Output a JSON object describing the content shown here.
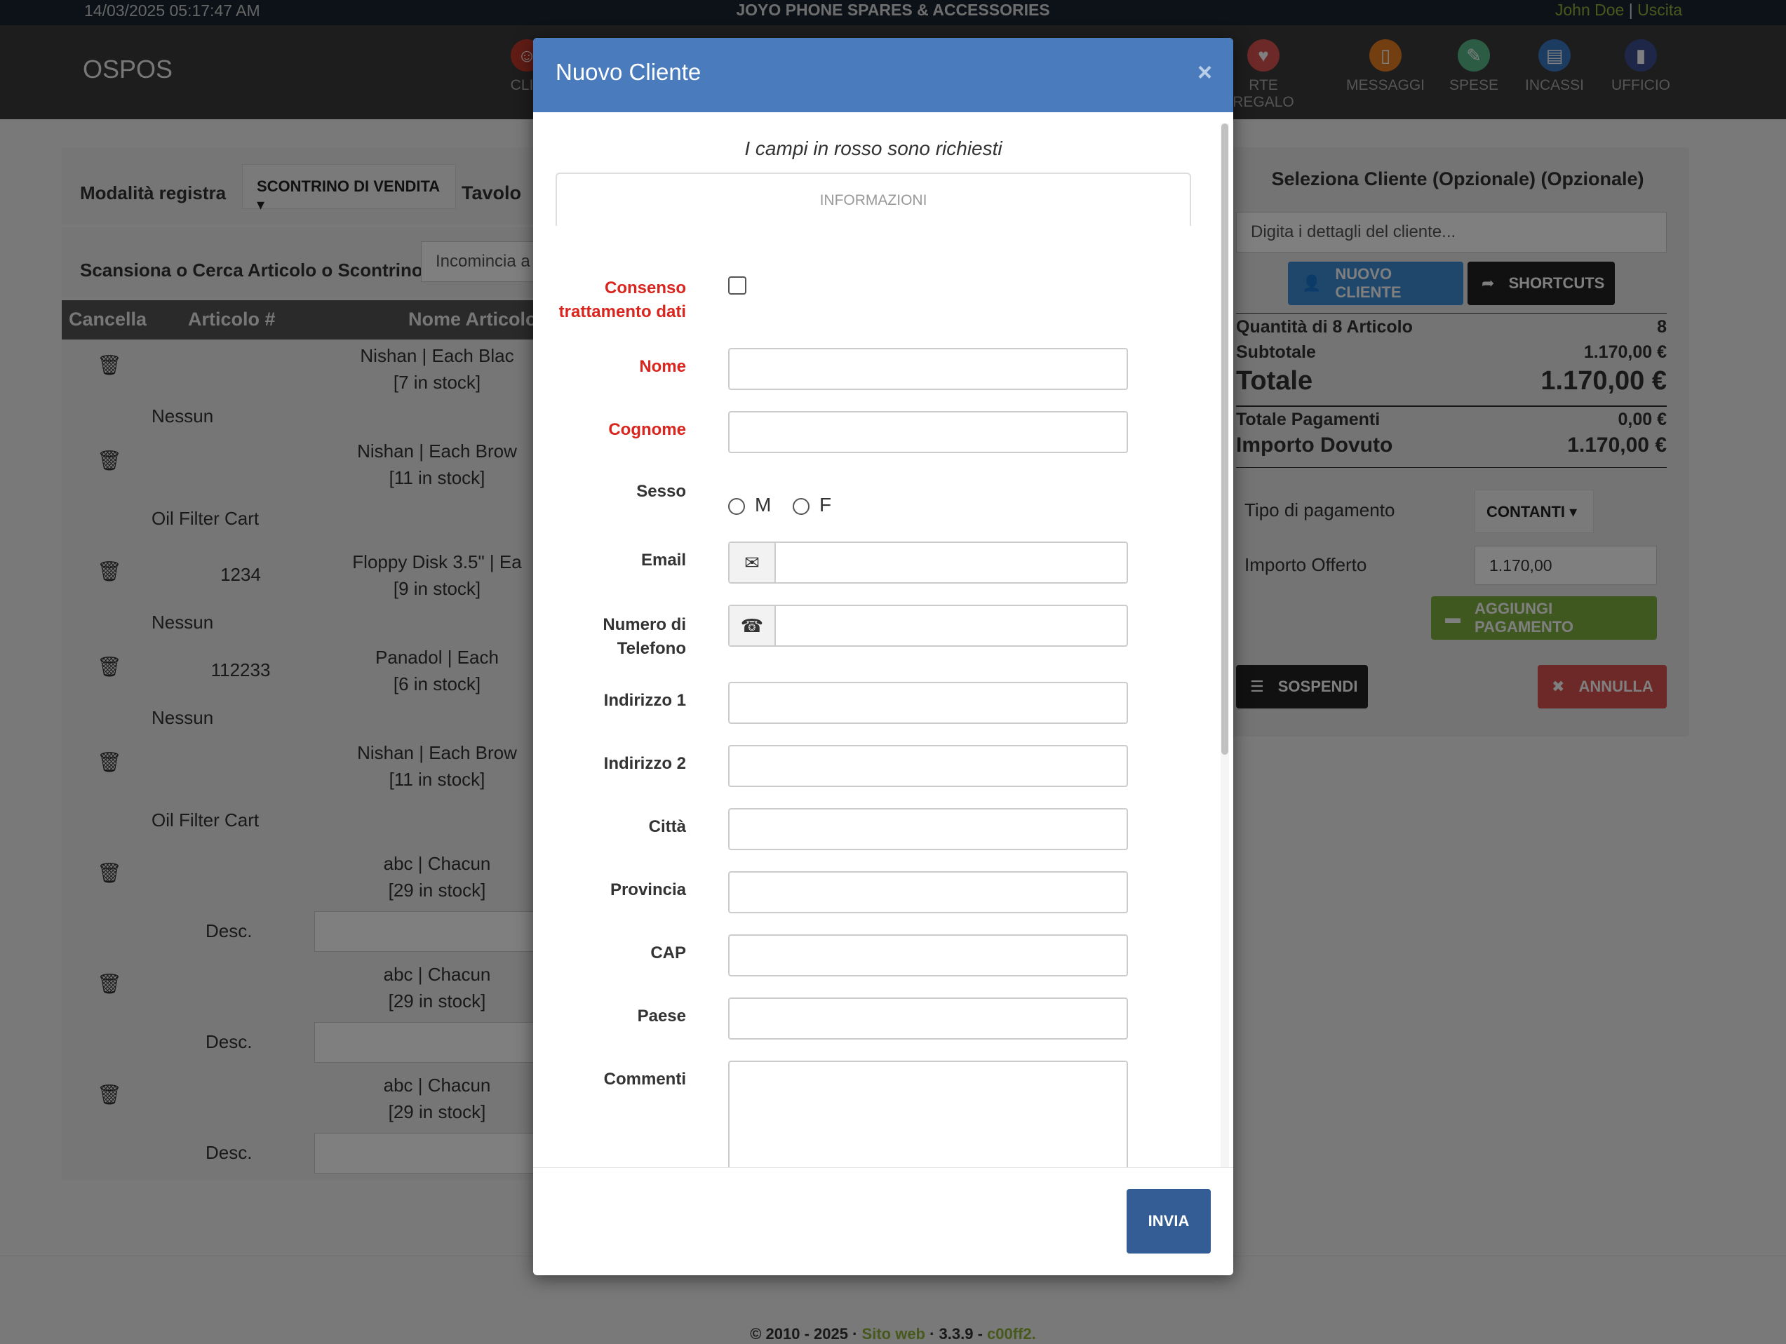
{
  "topbar": {
    "datetime": "14/03/2025 05:17:47 AM",
    "company": "JOYO PHONE SPARES & ACCESSORIES",
    "user": "John Doe",
    "separator": "|",
    "logout": "Uscita"
  },
  "navbar": {
    "brand": "OSPOS",
    "items": [
      {
        "label": "CLIE",
        "icon": "customers-icon",
        "color": "#c0392b"
      },
      {
        "label": "RTE REGALO",
        "icon": "gift-card-icon",
        "color": "#d9534f"
      },
      {
        "label": "MESSAGGI",
        "icon": "messages-icon",
        "color": "#e67e22"
      },
      {
        "label": "SPESE",
        "icon": "expenses-icon",
        "color": "#5bb88a"
      },
      {
        "label": "INCASSI",
        "icon": "cashups-icon",
        "color": "#3b78c4"
      },
      {
        "label": "UFFICIO",
        "icon": "office-icon",
        "color": "#3d4f8f"
      }
    ]
  },
  "register": {
    "mode_label": "Modalità registra",
    "mode_value": "SCONTRINO DI VENDITA",
    "table_label": "Tavolo"
  },
  "scan": {
    "label": "Scansiona o Cerca Articolo o Scontrino",
    "placeholder": "Incomincia a"
  },
  "cart": {
    "headers": {
      "cancel": "Cancella",
      "item_number": "Articolo #",
      "item_name": "Nome Articolo"
    },
    "items": [
      {
        "number": "",
        "name": "Nishan | Each Blac",
        "stock": "[7 in stock]",
        "extra": "Nessun",
        "extra_type": "text"
      },
      {
        "number": "",
        "name": "Nishan | Each Brow",
        "stock": "[11 in stock]",
        "extra": "Oil Filter Cart",
        "extra_type": "text"
      },
      {
        "number": "1234",
        "name": "Floppy Disk 3.5\" | Ea",
        "stock": "[9 in stock]",
        "extra": "Nessun",
        "extra_type": "text"
      },
      {
        "number": "112233",
        "name": "Panadol | Each",
        "stock": "[6 in stock]",
        "extra": "Nessun",
        "extra_type": "text"
      },
      {
        "number": "",
        "name": "Nishan | Each Brow",
        "stock": "[11 in stock]",
        "extra": "Oil Filter Cart",
        "extra_type": "text"
      },
      {
        "number": "",
        "name": "abc | Chacun",
        "stock": "[29 in stock]",
        "extra": "Desc.",
        "extra_type": "input"
      },
      {
        "number": "",
        "name": "abc | Chacun",
        "stock": "[29 in stock]",
        "extra": "Desc.",
        "extra_type": "input"
      },
      {
        "number": "",
        "name": "abc | Chacun",
        "stock": "[29 in stock]",
        "extra": "Desc.",
        "extra_type": "input"
      }
    ]
  },
  "summary": {
    "title": "Seleziona Cliente (Opzionale) (Opzionale)",
    "customer_placeholder": "Digita i dettagli del cliente...",
    "new_customer_button": "NUOVO CLIENTE",
    "shortcuts_button": "SHORTCUTS",
    "quantity_label": "Quantità di 8 Articolo",
    "quantity_value": "8",
    "subtotal_label": "Subtotale",
    "subtotal_value": "1.170,00 €",
    "total_label": "Totale",
    "total_value": "1.170,00 €",
    "payments_label": "Totale Pagamenti",
    "payments_value": "0,00 €",
    "due_label": "Importo Dovuto",
    "due_value": "1.170,00 €",
    "payment_type_label": "Tipo di pagamento",
    "payment_type_value": "CONTANTI",
    "tendered_label": "Importo Offerto",
    "tendered_value": "1.170,00",
    "add_payment_button": "AGGIUNGI PAGAMENTO",
    "suspend_button": "SOSPENDI",
    "cancel_button": "ANNULLA"
  },
  "footer": {
    "copyright": "© 2010 - 2025 · ",
    "website": "Sito web",
    "version": " · 3.3.9 - ",
    "commit": "c00ff2."
  },
  "modal": {
    "title": "Nuovo Cliente",
    "close": "×",
    "required_note": "I campi in rosso sono richiesti",
    "tab": "INFORMAZIONI",
    "fields": {
      "consent": "Consenso trattamento dati",
      "first_name": "Nome",
      "last_name": "Cognome",
      "gender": "Sesso",
      "gender_m": "M",
      "gender_f": "F",
      "email": "Email",
      "phone": "Numero di Telefono",
      "address1": "Indirizzo 1",
      "address2": "Indirizzo 2",
      "city": "Città",
      "state": "Provincia",
      "zip": "CAP",
      "country": "Paese",
      "comments": "Commenti"
    },
    "submit": "INVIA"
  },
  "colors": {
    "modal_header": "#4a7bbd",
    "required": "#d9251d",
    "submit": "#335d94",
    "accent_green": "#8fb339",
    "new_customer": "#3d8fd6",
    "add_payment": "#7fb03f",
    "cancel": "#d9534f"
  }
}
